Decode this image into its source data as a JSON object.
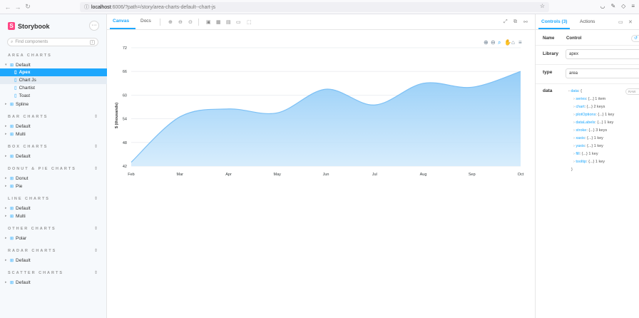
{
  "browser": {
    "url_host": "localhost",
    "url_rest": ":6006/?path=/story/area-charts-default--chart-js"
  },
  "sidebar": {
    "brand": "Storybook",
    "menu_label": "···",
    "search_placeholder": "Find components",
    "search_shortcut": "/",
    "sections": [
      {
        "title": "AREA CHARTS"
      },
      {
        "title": "BAR CHARTS"
      },
      {
        "title": "BOX CHARTS"
      },
      {
        "title": "DONUT & PIE CHARTS"
      },
      {
        "title": "LINE CHARTS"
      },
      {
        "title": "OTHER CHARTS"
      },
      {
        "title": "RADAR CHARTS"
      },
      {
        "title": "SCATTER CHARTS"
      }
    ],
    "items": {
      "area_default": "Default",
      "apex": "Apex",
      "chartjs": "Chart Js",
      "chartist": "Chartist",
      "toast": "Toast",
      "spline": "Spline",
      "bar_default": "Default",
      "bar_multi": "Multi",
      "box_default": "Default",
      "donut": "Donut",
      "pie": "Pie",
      "line_default": "Default",
      "line_multi": "Multi",
      "polar": "Polar",
      "radar_default": "Default",
      "scatter_default": "Default"
    }
  },
  "toolbar": {
    "canvas_tab": "Canvas",
    "docs_tab": "Docs"
  },
  "addons": {
    "controls_tab": "Controls (3)",
    "actions_tab": "Actions",
    "col_name": "Name",
    "col_control": "Control",
    "library_label": "Library",
    "library_value": "apex",
    "type_label": "type",
    "type_value": "area",
    "data_label": "data",
    "raw_label": "RAW",
    "json": {
      "root_key": "data",
      "root_open": ": {",
      "entries": [
        {
          "key": "series",
          "value": ": [...] 1 item"
        },
        {
          "key": "chart",
          "value": ": {...} 2 keys"
        },
        {
          "key": "plotOptions",
          "value": ": {...} 1 key"
        },
        {
          "key": "dataLabels",
          "value": ": {...} 1 key"
        },
        {
          "key": "stroke",
          "value": ": {...} 3 keys"
        },
        {
          "key": "xaxis",
          "value": ": {...} 1 key"
        },
        {
          "key": "yaxis",
          "value": ": {...} 1 key"
        },
        {
          "key": "fill",
          "value": ": {...} 1 key"
        },
        {
          "key": "tooltip",
          "value": ": {...} 1 key"
        }
      ],
      "close": "}"
    }
  },
  "colors": {
    "accent": "#1ea7fd",
    "brand": "#ff4785",
    "area_fill": "#9fd0f7"
  },
  "chart_data": {
    "type": "area",
    "categories": [
      "Feb",
      "Mar",
      "Apr",
      "May",
      "Jun",
      "Jul",
      "Aug",
      "Sep",
      "Oct"
    ],
    "values": [
      43,
      54.5,
      56.5,
      55.5,
      61.5,
      57.5,
      63,
      62,
      66
    ],
    "ylabel": "$ (thousands)",
    "ylim": [
      42,
      72
    ],
    "yticks": [
      42,
      48,
      54,
      60,
      66,
      72
    ]
  }
}
